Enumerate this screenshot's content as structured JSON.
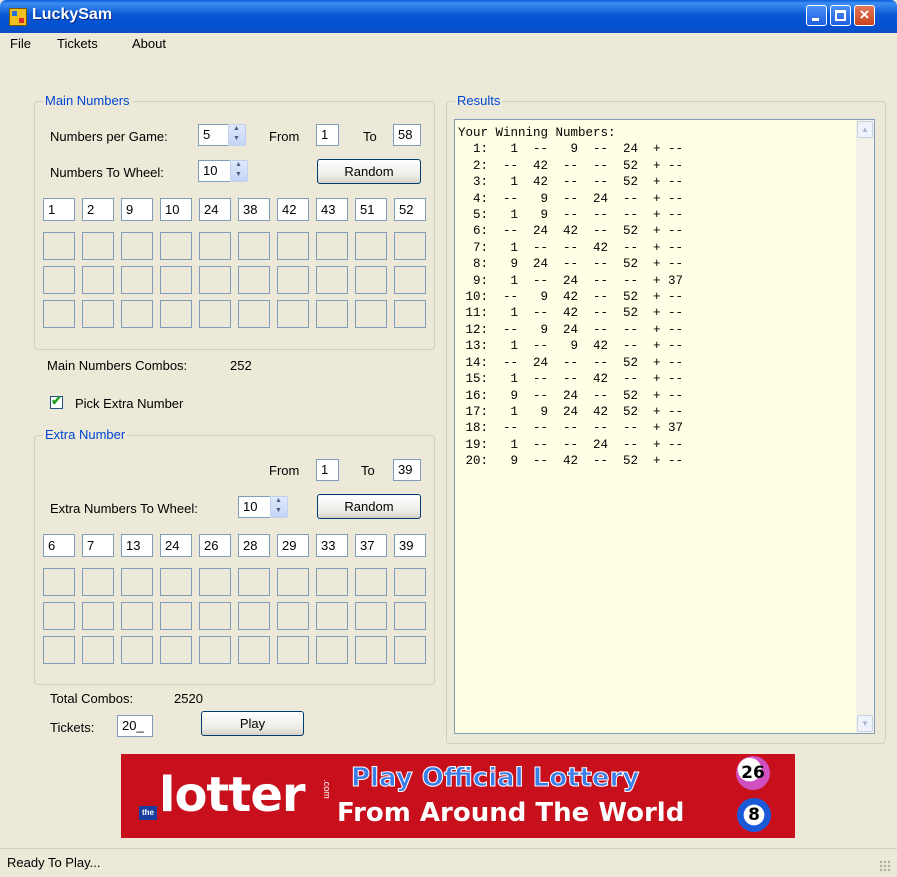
{
  "window": {
    "title": "LuckySam"
  },
  "menu": {
    "items": [
      "File",
      "Tickets",
      "About"
    ]
  },
  "main_numbers": {
    "group_title": "Main Numbers",
    "numbers_per_game_label": "Numbers per Game:",
    "numbers_per_game": "5",
    "from_label": "From",
    "from_value": "1",
    "to_label": "To",
    "to_value": "58",
    "wheel_label": "Numbers To Wheel:",
    "wheel_value": "10",
    "random_label": "Random",
    "selected": [
      "1",
      "2",
      "9",
      "10",
      "24",
      "38",
      "42",
      "43",
      "51",
      "52"
    ],
    "combos_label": "Main Numbers Combos:",
    "combos_value": "252"
  },
  "pick_extra": {
    "label": "Pick Extra Number",
    "checked": true
  },
  "extra_number": {
    "group_title": "Extra Number",
    "from_label": "From",
    "from_value": "1",
    "to_label": "To",
    "to_value": "39",
    "wheel_label": "Extra Numbers To Wheel:",
    "wheel_value": "10",
    "random_label": "Random",
    "selected": [
      "6",
      "7",
      "13",
      "24",
      "26",
      "28",
      "29",
      "33",
      "37",
      "39"
    ]
  },
  "totals": {
    "total_combos_label": "Total Combos:",
    "total_combos_value": "2520",
    "tickets_label": "Tickets:",
    "tickets_value": "20_",
    "play_label": "Play"
  },
  "results": {
    "group_title": "Results",
    "header": "Your Winning Numbers:",
    "rows": [
      "  1:   1  --   9  --  24  + --",
      "  2:  --  42  --  --  52  + --",
      "  3:   1  42  --  --  52  + --",
      "  4:  --   9  --  24  --  + --",
      "  5:   1   9  --  --  --  + --",
      "  6:  --  24  42  --  52  + --",
      "  7:   1  --  --  42  --  + --",
      "  8:   9  24  --  --  52  + --",
      "  9:   1  --  24  --  --  + 37",
      " 10:  --   9  42  --  52  + --",
      " 11:   1  --  42  --  52  + --",
      " 12:  --   9  24  --  --  + --",
      " 13:   1  --   9  42  --  + --",
      " 14:  --  24  --  --  52  + --",
      " 15:   1  --  --  42  --  + --",
      " 16:   9  --  24  --  52  + --",
      " 17:   1   9  24  42  52  + --",
      " 18:  --  --  --  --  --  + 37",
      " 19:   1  --  --  24  --  + --",
      " 20:   9  --  42  --  52  + --"
    ]
  },
  "banner": {
    "brand": "lotter",
    "brand_prefix": "the",
    "brand_suffix": ".com",
    "line1": "Play Official Lottery",
    "line2": "From Around The World",
    "ball1": "26",
    "ball2": "8"
  },
  "status": {
    "text": "Ready To Play..."
  }
}
